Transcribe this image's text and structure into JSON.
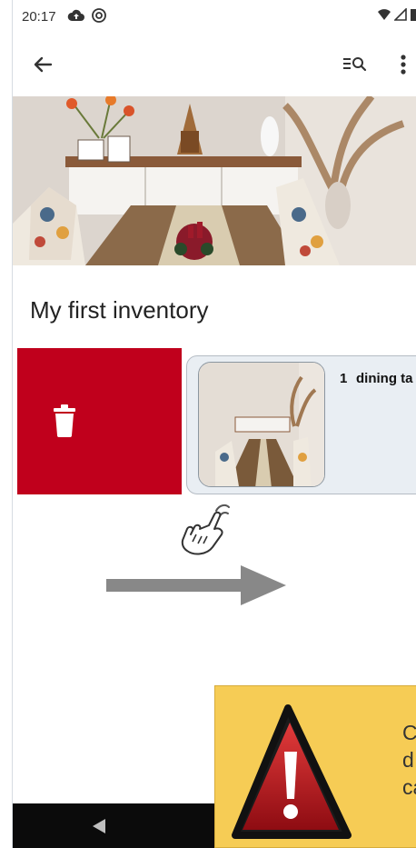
{
  "status_bar": {
    "time": "20:17",
    "icons_left": [
      "cloud-upload-icon",
      "at-sign-icon"
    ],
    "icons_right": [
      "wifi-icon",
      "signal-icon",
      "battery-icon"
    ]
  },
  "app_bar": {
    "back_icon": "arrow-back-icon",
    "actions": [
      "search-list-icon",
      "more-vert-icon"
    ]
  },
  "inventory": {
    "title": "My first inventory"
  },
  "item": {
    "quantity": "1",
    "name": "dining ta"
  },
  "overlay": {
    "hand_icon": "swipe-hand-icon",
    "arrow_direction": "right"
  },
  "warning": {
    "text_lines": [
      "C",
      "d",
      "ca"
    ]
  },
  "colors": {
    "delete_red": "#c0001c",
    "card_bg": "#e9eef3",
    "warning_yellow": "#f6cc55",
    "arrow_gray": "#888888"
  }
}
